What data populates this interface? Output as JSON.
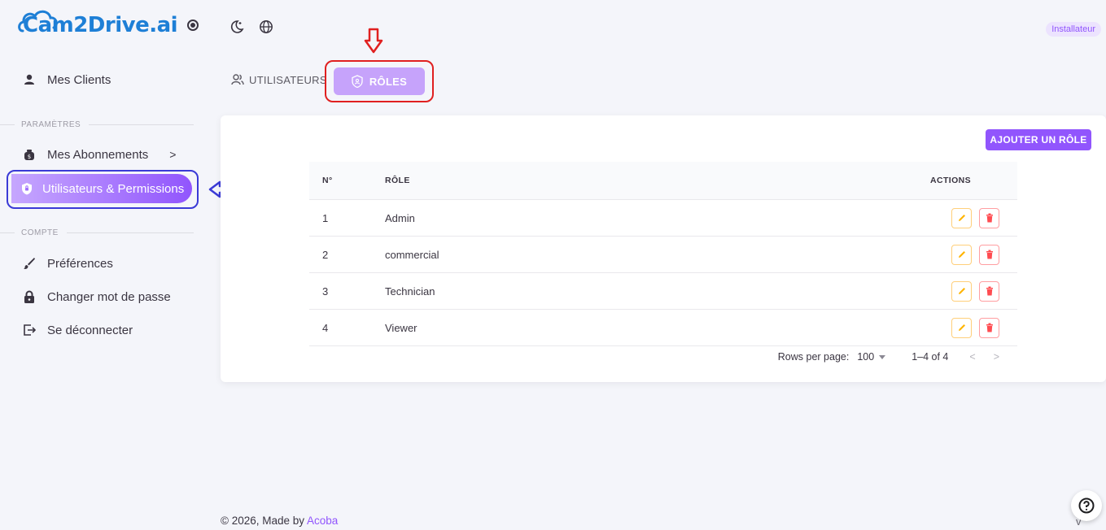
{
  "brand": {
    "name": "Cam2Drive.ai"
  },
  "sidebar": {
    "clients": "Mes Clients",
    "section_params": "PARAMÈTRES",
    "subscriptions": "Mes Abonnements",
    "subscriptions_chevron": ">",
    "users_permissions": "Utilisateurs & Permissions",
    "section_account": "COMPTE",
    "preferences": "Préférences",
    "change_password": "Changer mot de passe",
    "logout": "Se déconnecter"
  },
  "header": {
    "role_badge": "Installateur"
  },
  "tabs": [
    {
      "label": "UTILISATEURS",
      "active": false
    },
    {
      "label": "RÔLES",
      "active": true
    }
  ],
  "card": {
    "add_button": "AJOUTER UN RÔLE",
    "columns": {
      "num": "N°",
      "role": "RÔLE",
      "actions": "ACTIONS"
    },
    "rows": [
      {
        "num": "1",
        "role": "Admin"
      },
      {
        "num": "2",
        "role": "commercial"
      },
      {
        "num": "3",
        "role": "Technician"
      },
      {
        "num": "4",
        "role": "Viewer"
      }
    ],
    "pager": {
      "rows_label": "Rows per page:",
      "rows_value": "100",
      "range": "1–4 of 4",
      "prev": "<",
      "next": ">"
    }
  },
  "footer": {
    "copyright": "© 2026, Made by",
    "company": "Acoba"
  },
  "version": "v 1.1.0",
  "colors": {
    "primary": "#9155fd",
    "warning": "#ffb400",
    "error": "#ff4c51",
    "annotation_red": "#e02020",
    "annotation_blue": "#3a3ad6"
  }
}
